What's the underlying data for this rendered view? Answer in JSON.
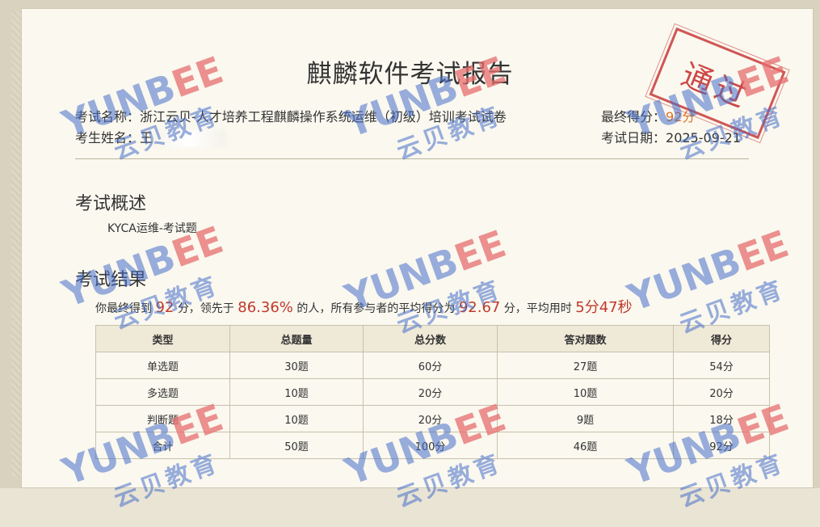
{
  "report": {
    "title": "麒麟软件考试报告",
    "exam_name_label": "考试名称：",
    "exam_name": "浙江云贝-人才培养工程麒麟操作系统运维（初级）培训考试试卷",
    "examinee_label": "考生姓名：",
    "examinee_name": "王",
    "final_score_label": "最终得分：",
    "final_score": "92分",
    "exam_date_label": "考试日期：",
    "exam_date": "2025-09-21",
    "stamp_text": "通过"
  },
  "overview": {
    "heading": "考试概述",
    "description": "KYCA运维-考试题"
  },
  "results": {
    "heading": "考试结果",
    "summary_pre": "你最终得到",
    "score": "92",
    "summary_mid1": "分，领先于",
    "percentile": "86.36%",
    "summary_mid2": "的人，所有参与者的平均得分为",
    "average": "92.67",
    "summary_mid3": "分，平均用时",
    "avg_time": "5分47秒",
    "table": {
      "headers": [
        "类型",
        "总题量",
        "总分数",
        "答对题数",
        "得分"
      ],
      "rows": [
        [
          "单选题",
          "30题",
          "60分",
          "27题",
          "54分"
        ],
        [
          "多选题",
          "10题",
          "20分",
          "10题",
          "20分"
        ],
        [
          "判断题",
          "10题",
          "20分",
          "9题",
          "18分"
        ],
        [
          "合计",
          "50题",
          "100分",
          "46题",
          "92分"
        ]
      ]
    }
  },
  "watermark": {
    "en_left": "YUNB",
    "en_accent": "EE",
    "cn": "云贝教育"
  },
  "colors": {
    "accent_red": "#c0392b",
    "accent_orange": "#e07020",
    "watermark_blue": "#466ec8"
  }
}
